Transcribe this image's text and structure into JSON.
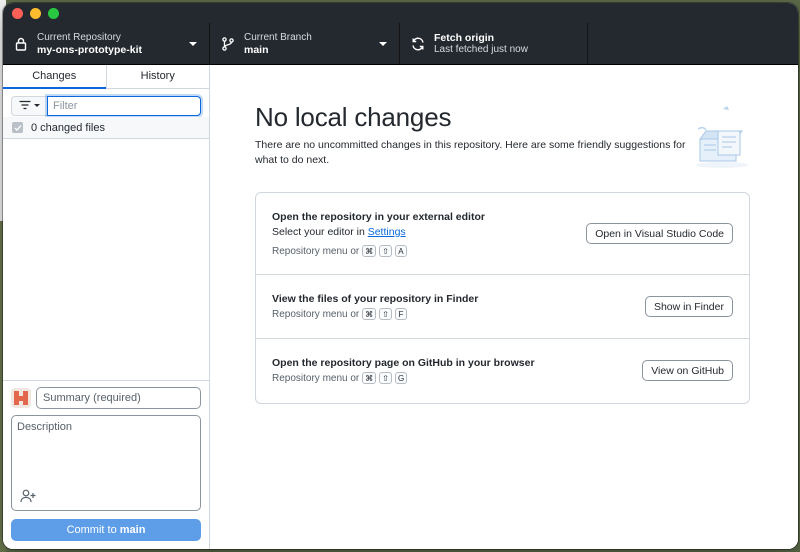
{
  "toolbar": {
    "repo_label": "Current Repository",
    "repo_value": "my-ons-prototype-kit",
    "branch_label": "Current Branch",
    "branch_value": "main",
    "fetch_label": "Fetch origin",
    "fetch_value": "Last fetched just now"
  },
  "sidebar": {
    "tabs": [
      {
        "label": "Changes",
        "active": true
      },
      {
        "label": "History",
        "active": false
      }
    ],
    "filter_placeholder": "Filter",
    "changed_files": "0 changed files",
    "summary_placeholder": "Summary (required)",
    "description_placeholder": "Description",
    "commit_prefix": "Commit to ",
    "commit_branch": "main"
  },
  "content": {
    "heading": "No local changes",
    "subtext": "There are no uncommitted changes in this repository. Here are some friendly suggestions for what to do next.",
    "cards": [
      {
        "title": "Open the repository in your external editor",
        "sub_prefix": "Select your editor in ",
        "sub_link": "Settings",
        "hint": "Repository menu or",
        "keys": [
          "⌘",
          "⇧",
          "A"
        ],
        "button": "Open in Visual Studio Code"
      },
      {
        "title": "View the files of your repository in Finder",
        "hint": "Repository menu or",
        "keys": [
          "⌘",
          "⇧",
          "F"
        ],
        "button": "Show in Finder"
      },
      {
        "title": "Open the repository page on GitHub in your browser",
        "hint": "Repository menu or",
        "keys": [
          "⌘",
          "⇧",
          "G"
        ],
        "button": "View on GitHub"
      }
    ]
  },
  "colors": {
    "toolbar_bg": "#24292f",
    "accent": "#0969da",
    "commit_button": "#5e9ee8"
  },
  "icons": {
    "repo": "lock-icon",
    "branch": "git-branch-icon",
    "fetch": "sync-icon",
    "filter": "filter-icon",
    "coauthor": "person-add-icon"
  }
}
